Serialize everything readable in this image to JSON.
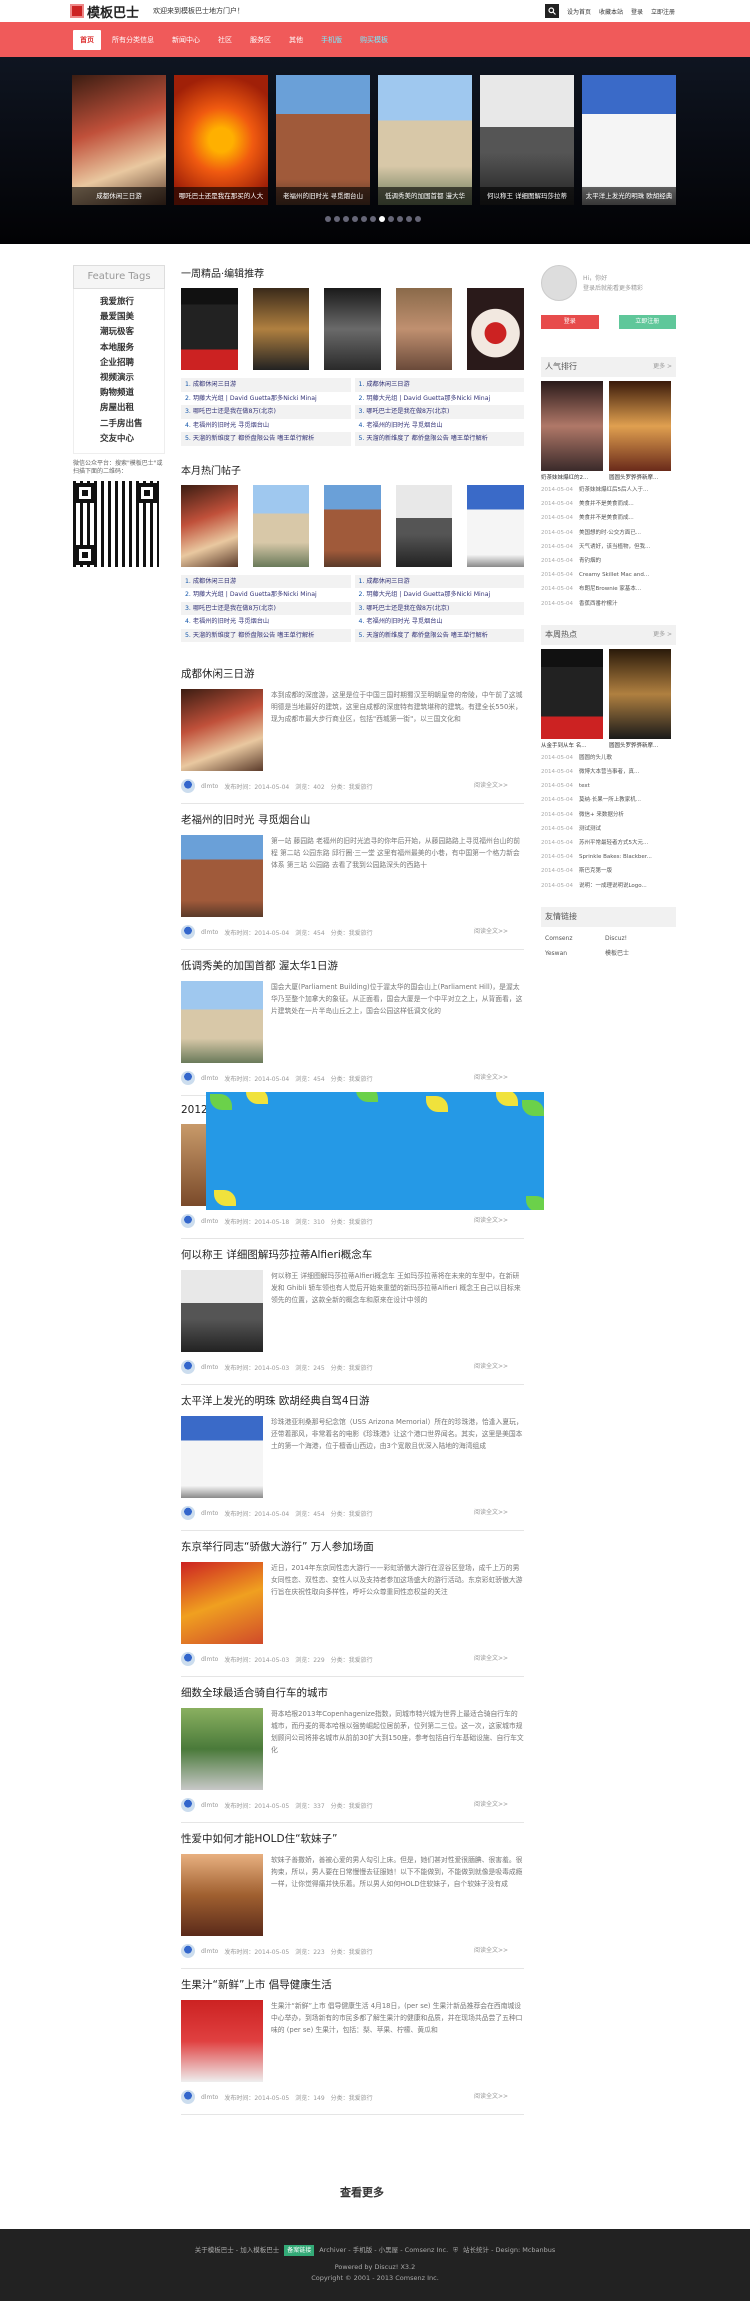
{
  "header": {
    "site_name": "模板巴士",
    "welcome": "欢迎来到模板巴士地方门户！",
    "links": [
      "设为首页",
      "收藏本站",
      "登录",
      "立即注册"
    ]
  },
  "nav": {
    "items": [
      {
        "label": "首页",
        "active": true
      },
      {
        "label": "所有分类信息"
      },
      {
        "label": "新闻中心"
      },
      {
        "label": "社区"
      },
      {
        "label": "服务区"
      },
      {
        "label": "其他"
      },
      {
        "label": "手机版",
        "hl": true
      },
      {
        "label": "购买模板",
        "hl": true
      }
    ]
  },
  "slider": {
    "captions": [
      "成都休闲三日游",
      "哪吒巴士还是我在那买的人大",
      "老福州的旧时光 寻觅烟台山",
      "低调秀美的加国首都 漫大华",
      "何以称王 详细图解玛莎拉蒂",
      "太平洋上发光的明珠 欧胡经典"
    ],
    "dot_count": 11,
    "active_dot": 6
  },
  "feature": {
    "title": "Feature Tags",
    "items": [
      "我爱旅行",
      "最爱国美",
      "潮玩极客",
      "本地服务",
      "企业招聘",
      "视频演示",
      "购物频道",
      "房屋出租",
      "二手房出售",
      "交友中心"
    ],
    "wechat_text": "微信公众平台：搜索\"模板巴士\"或扫描下面的二维码："
  },
  "weekly": {
    "title": "一周精品·编辑推荐",
    "left": [
      "成都休闲三日游",
      "玥藤大光组 | David Guetta那多Nicki Minaj",
      "哪吒巴士还是我在做8万(北京)",
      "老福州的旧时光 寻觅烟台山",
      "天溜的新维度了 都侨盘限公告 嗜王单行解析"
    ],
    "right": [
      "成都休闲三日游",
      "玥藤大光组 | David Guetta那多Nicki Minaj",
      "哪吒巴士还是我在做8万(北京)",
      "老福州的旧时光 寻觅烟台山",
      "天溜的新维度了 都侨盘限公告 嗜王单行解析"
    ]
  },
  "hot": {
    "title": "本月热门帖子",
    "left": [
      "成都休闲三日游",
      "玥藤大光组 | David Guetta那多Nicki Minaj",
      "哪吒巴士还是我在做8万(北京)",
      "老福州的旧时光 寻觅烟台山",
      "天溜的新维度了 都侨盘限公告 嗜王单行解析"
    ],
    "right": [
      "成都休闲三日游",
      "玥藤大光组 | David Guetta那多Nicki Minaj",
      "哪吒巴士还是我在做8万(北京)",
      "老福州的旧时光 寻觅烟台山",
      "天溜的新维度了 都侨盘限公告 嗜王单行解析"
    ]
  },
  "posts": [
    {
      "title": "成都休闲三日游",
      "desc": "本到成都的深度游，这里是位于中国三国时期蜀汉至明朝皇帝的帝陵，中午前了这城明德是当地最好的建筑，这里自成都的深度特有建筑堪称的建筑。有建全长550米，现为成都市最大步行商业区，包括\"西城第一街\"，以三国文化和",
      "author": "dlmto",
      "date": "发布时间：2014-05-04",
      "views": "浏览：402",
      "cat": "分类：我爱旅行",
      "more": "阅读全文>>"
    },
    {
      "title": "老福州的旧时光 寻觅烟台山",
      "desc": "第一站 藤园路 老福州的旧时光追寻的你年后开始，从藤园路路上寻觅福州台山的前程 第二站 公园东路 邱行圈·三一堂 这里有福州最美的小巷，有中国第一个格力新会体系 第三站 公园路 去看了我到公园路深头的西路十",
      "author": "dlmto",
      "date": "发布时间：2014-05-04",
      "views": "浏览：454",
      "cat": "分类：我爱旅行",
      "more": "阅读全文>>"
    },
    {
      "title": "低调秀美的加国首都 渥太华1日游",
      "desc": "国会大厦(Parliament Building)位于渥太华的国会山上(Parliament Hill)，是渥太华乃至整个加拿大的象征。从正面看，国会大厦是一个中平对立之上，从背面看，这片建筑处在一片半岛山丘之上，国会公园这样低调文化的",
      "author": "dlmto",
      "date": "发布时间：2014-05-04",
      "views": "浏览：454",
      "cat": "分类：我爱旅行",
      "more": "阅读全文>>"
    },
    {
      "title": "2012",
      "desc": "",
      "author": "dlmto",
      "date": "发布时间：2014-05-18",
      "views": "浏览：310",
      "cat": "分类：我爱旅行",
      "more": "阅读全文>>"
    },
    {
      "title": "何以称王 详细图解玛莎拉蒂Alfieri概念车",
      "desc": "何以称王 详细图解玛莎拉蒂Alfieri概念车 王如玛莎拉蒂将在未来的车型中，在新研发和 Ghibli 轿车领也有人觉后开始来重塑的新玛莎拉蒂Alfieri 概念王自己以目标来领先的位置，这款全新的概念车和原来在设计中领的",
      "author": "dlmto",
      "date": "发布时间：2014-05-03",
      "views": "浏览：245",
      "cat": "分类：我爱旅行",
      "more": "阅读全文>>"
    },
    {
      "title": "太平洋上发光的明珠 欧胡经典自驾4日游",
      "desc": "珍珠港亚利桑那号纪念馆（USS Arizona Memorial）所在的珍珠港，恰逢入夏玩，还带着那风，非常着名的电影《珍珠港》让这个港口世界闻名。其实，这里是美国本土的第一个海港，位于檀香山西边，由3个宽敞且优深入陆地的海湾组成",
      "author": "dlmto",
      "date": "发布时间：2014-05-04",
      "views": "浏览：454",
      "cat": "分类：我爱旅行",
      "more": "阅读全文>>"
    },
    {
      "title": "东京举行同志“骄傲大游行” 万人参加场面",
      "desc": "近日，2014年东京同性恋大游行——彩虹骄傲大游行在涩谷区登场，成千上万的男女同性恋、双性恋、变性人以及支持者参加这场盛大的游行活动。东京彩虹骄傲大游行旨在庆祝性取向多样性，呼吁公众尊重同性恋权益的关注",
      "author": "dlmto",
      "date": "发布时间：2014-05-03",
      "views": "浏览：229",
      "cat": "分类：我爱旅行",
      "more": "阅读全文>>"
    },
    {
      "title": "细数全球最适合骑自行车的城市",
      "desc": "哥本哈根2013年Copenhagenize指数，同城市特兴城为世界上最适合骑自行车的城市，而丹麦的哥本哈根以强势崛起位居前茅，位列第二三位。这一次，这家城市规划顾问公司将排名城市从前前30扩大到150座，参考包括自行车基础设施、自行车文化",
      "author": "dlmto",
      "date": "发布时间：2014-05-05",
      "views": "浏览：337",
      "cat": "分类：我爱旅行",
      "more": "阅读全文>>"
    },
    {
      "title": "性爱中如何才能HOLD住“软妹子”",
      "desc": "软妹子善撒娇，善被心爱的男人勾引上床。但是，她们甚对性爱很腼腆、很害羞。很拘束，所以，男人要在日常慢慢去征服她！以下不能做到，不能做到就像是吸毒成瘾一样，让你觉得痛并快乐着。所以男人如何HOLD住软妹子，自个软妹子没有成",
      "author": "dlmto",
      "date": "发布时间：2014-05-05",
      "views": "浏览：223",
      "cat": "分类：我爱旅行",
      "more": "阅读全文>>"
    },
    {
      "title": "生果汁“新鲜”上市 倡导健康生活",
      "desc": "生果汁“新鲜”上市 倡导健康生活 4月18日，(per se) 生果汁新品推荐会在西南城设中心举办，到场新有的市民多都了解生果汁的健康和品质，并在现场共品尝了五种口味的 (per se) 生果汁，包括：梨、苹果、柠檬、黄瓜和",
      "author": "dlmto",
      "date": "发布时间：2014-05-05",
      "views": "浏览：149",
      "cat": "分类：我爱旅行",
      "more": "阅读全文>>"
    }
  ],
  "load_more": "查看更多",
  "user": {
    "greeting": "Hi，你好",
    "sub": "登录后就能看更多精彩",
    "login": "登录",
    "register": "立即注册"
  },
  "popular": {
    "title": "人气排行",
    "more": "更多 >",
    "captions": [
      "奶茶妹妹爆红的2...",
      "圆圆头罗骅骅新摩..."
    ],
    "rows": [
      {
        "d": "2014-05-04",
        "t": "奶茶妹妹爆红后5后人入于..."
      },
      {
        "d": "2014-05-04",
        "t": "美食并不是美食而成..."
      },
      {
        "d": "2014-05-04",
        "t": "美食并不是美食而成..."
      },
      {
        "d": "2014-05-04",
        "t": "美国想的时·公交方面已..."
      },
      {
        "d": "2014-05-04",
        "t": "天气诱好，该当植物，但我..."
      },
      {
        "d": "2014-05-04",
        "t": "青钓烟的"
      },
      {
        "d": "2014-05-04",
        "t": "Creamy Skillet Mac and..."
      },
      {
        "d": "2014-05-04",
        "t": "布朗尼Brownie 家基本..."
      },
      {
        "d": "2014-05-04",
        "t": "香蕉西番柠檬汁"
      }
    ]
  },
  "hotspot": {
    "title": "本周热点",
    "more": "更多 >",
    "captions": [
      "从金手到从车 名...",
      "圆圆头罗骅骅新摩..."
    ],
    "rows": [
      {
        "d": "2014-05-04",
        "t": "圆圆的头儿歌"
      },
      {
        "d": "2014-05-04",
        "t": "微博大本营当事者，真..."
      },
      {
        "d": "2014-05-04",
        "t": "text"
      },
      {
        "d": "2014-05-04",
        "t": "莫纳·长果一所上教家机..."
      },
      {
        "d": "2014-05-04",
        "t": "微信+ 来数据分析"
      },
      {
        "d": "2014-05-04",
        "t": "测试测试"
      },
      {
        "d": "2014-05-04",
        "t": "苏州平常最轻者方式5大元..."
      },
      {
        "d": "2014-05-04",
        "t": "Sprinkle Bakes: Blackber..."
      },
      {
        "d": "2014-05-04",
        "t": "斯巴克第一版"
      },
      {
        "d": "2014-05-04",
        "t": "说明：一成理说明说Logo..."
      }
    ]
  },
  "friends": {
    "title": "友情链接",
    "items": [
      "Comsenz",
      "Discuz!",
      "Yeswan",
      "模板巴士"
    ]
  },
  "footer": {
    "line1a": "关于模板巴士 - 加入模板巴士",
    "badge": "备案链接",
    "line1b": "Archiver - 手机版 - 小黑屋 - Comsenz Inc.",
    "line1c": "站长统计 - Design: Mcbanbus",
    "powered": "Powered by Discuz! X3.2",
    "copyright": "Copyright © 2001 - 2013 Comsenz Inc."
  },
  "colors": {
    "brand": "#f05a5a",
    "accent_login": "#e74c4c",
    "accent_register": "#5fc79a"
  }
}
